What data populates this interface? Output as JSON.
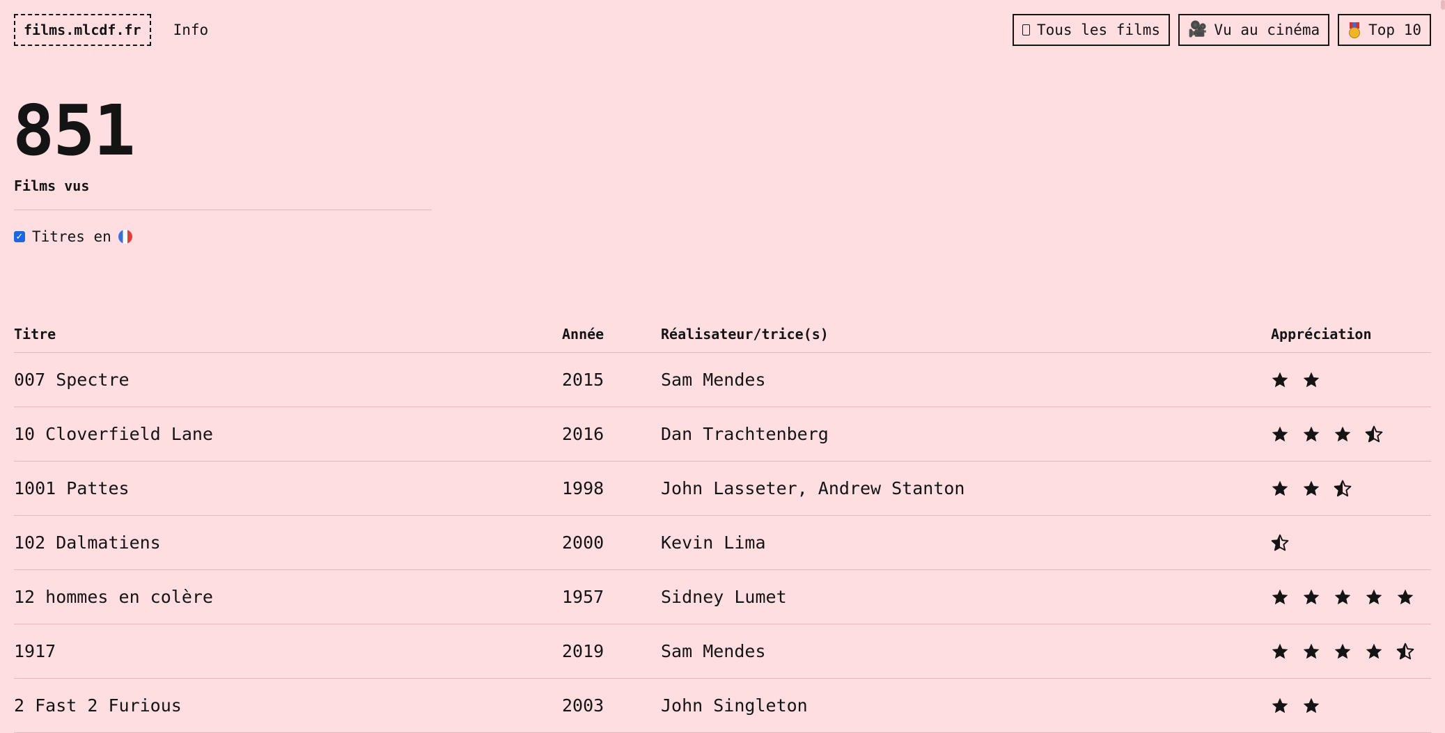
{
  "header": {
    "logo": "films.mlcdf.fr",
    "info_link": "Info",
    "nav": [
      {
        "label": "Tous les films",
        "icon": "tablet-icon"
      },
      {
        "label": "Vu au cinéma",
        "icon": "film-camera-icon"
      },
      {
        "label": "Top 10",
        "icon": "medal-icon"
      }
    ]
  },
  "stats": {
    "count": "851",
    "label": "Films vus"
  },
  "toggle": {
    "label": "Titres en",
    "checked": true,
    "flag": "french-flag-icon"
  },
  "table": {
    "headers": {
      "title": "Titre",
      "year": "Année",
      "director": "Réalisateur/trice(s)",
      "rating": "Appréciation"
    },
    "rows": [
      {
        "title": "007 Spectre",
        "year": "2015",
        "director": "Sam Mendes",
        "rating": 2
      },
      {
        "title": "10 Cloverfield Lane",
        "year": "2016",
        "director": "Dan Trachtenberg",
        "rating": 3.5
      },
      {
        "title": "1001 Pattes",
        "year": "1998",
        "director": "John Lasseter, Andrew Stanton",
        "rating": 2.5
      },
      {
        "title": "102 Dalmatiens",
        "year": "2000",
        "director": "Kevin Lima",
        "rating": 0.5
      },
      {
        "title": "12 hommes en colère",
        "year": "1957",
        "director": "Sidney Lumet",
        "rating": 5
      },
      {
        "title": "1917",
        "year": "2019",
        "director": "Sam Mendes",
        "rating": 4.5
      },
      {
        "title": "2 Fast 2 Furious",
        "year": "2003",
        "director": "John Singleton",
        "rating": 2
      }
    ]
  }
}
